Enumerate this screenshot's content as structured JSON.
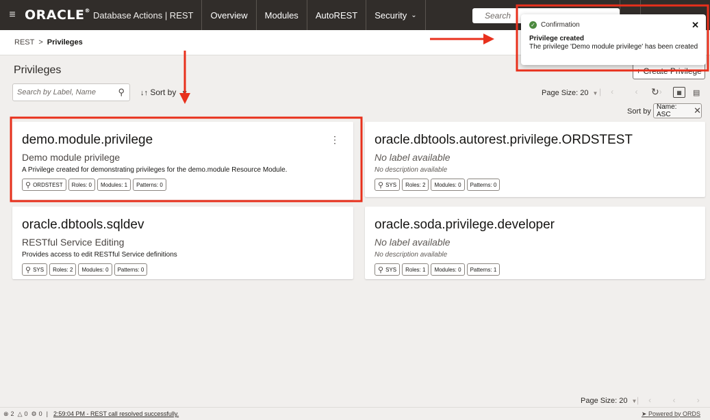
{
  "header": {
    "logo_text": "ORACLE",
    "app_title": "Database Actions | REST",
    "nav": [
      "Overview",
      "Modules",
      "AutoREST",
      "Security"
    ],
    "search_placeholder": "Search"
  },
  "breadcrumb": {
    "root": "REST",
    "separator": ">",
    "current": "Privileges"
  },
  "page": {
    "title": "Privileges",
    "create_button": "+ Create Privilege",
    "search_placeholder": "Search by Label, Name",
    "sort_by_button": "Sort by",
    "page_size": "Page Size: 20",
    "sort_by_label": "Sort by",
    "sort_chip": "Name: ASC"
  },
  "cards": [
    {
      "name": "demo.module.privilege",
      "label": "Demo module privilege",
      "description": "A Privilege created for demonstrating privileges for the demo.module Resource Module.",
      "owner": "ORDSTEST",
      "roles": "Roles: 0",
      "modules": "Modules: 1",
      "patterns": "Patterns: 0"
    },
    {
      "name": "oracle.dbtools.autorest.privilege.ORDSTEST",
      "label": "No label available",
      "description": "No description available",
      "owner": "SYS",
      "roles": "Roles: 2",
      "modules": "Modules: 0",
      "patterns": "Patterns: 0"
    },
    {
      "name": "oracle.dbtools.sqldev",
      "label": "RESTful Service Editing",
      "description": "Provides access to edit RESTful Service definitions",
      "owner": "SYS",
      "roles": "Roles: 2",
      "modules": "Modules: 0",
      "patterns": "Patterns: 0"
    },
    {
      "name": "oracle.soda.privilege.developer",
      "label": "No label available",
      "description": "No description available",
      "owner": "SYS",
      "roles": "Roles: 1",
      "modules": "Modules: 0",
      "patterns": "Patterns: 1"
    }
  ],
  "footer": {
    "page_size": "Page Size: 20"
  },
  "statusbar": {
    "errors": "2",
    "warnings": "0",
    "processes": "0",
    "message": "2:59:04 PM - REST call resolved successfully.",
    "powered": "Powered by ORDS"
  },
  "toast": {
    "heading": "Confirmation",
    "title": "Privilege created",
    "message": "The privilege 'Demo module privilege' has been created"
  },
  "colors": {
    "annotation_red": "#e8301c",
    "header_bg": "#312d2a",
    "success_green": "#4c8a3f"
  }
}
